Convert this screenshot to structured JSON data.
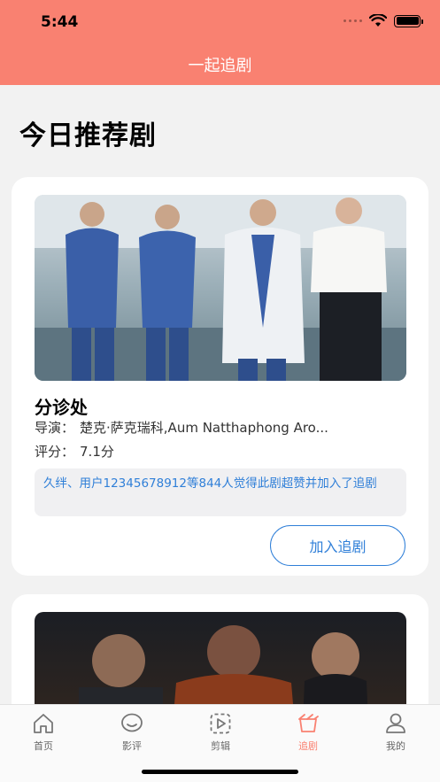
{
  "status_bar": {
    "time": "5:44"
  },
  "nav": {
    "title": "一起追剧"
  },
  "section": {
    "title": "今日推荐剧"
  },
  "cards": [
    {
      "title": "分诊处",
      "director_label": "导演：",
      "director": "楚克·萨克瑞科,Aum Natthaphong Aro...",
      "rating_label": "评分：",
      "rating": "7.1分",
      "like_text": "久绊、用户12345678912等844人觉得此剧超赞并加入了追剧",
      "follow_label": "加入追剧"
    }
  ],
  "tabs": [
    {
      "label": "首页",
      "icon": "home-icon"
    },
    {
      "label": "影评",
      "icon": "chat-icon"
    },
    {
      "label": "剪辑",
      "icon": "play-icon"
    },
    {
      "label": "追剧",
      "icon": "clapper-icon",
      "active": true
    },
    {
      "label": "我的",
      "icon": "user-icon"
    }
  ],
  "colors": {
    "accent": "#f98171",
    "link": "#2f7fd8"
  }
}
